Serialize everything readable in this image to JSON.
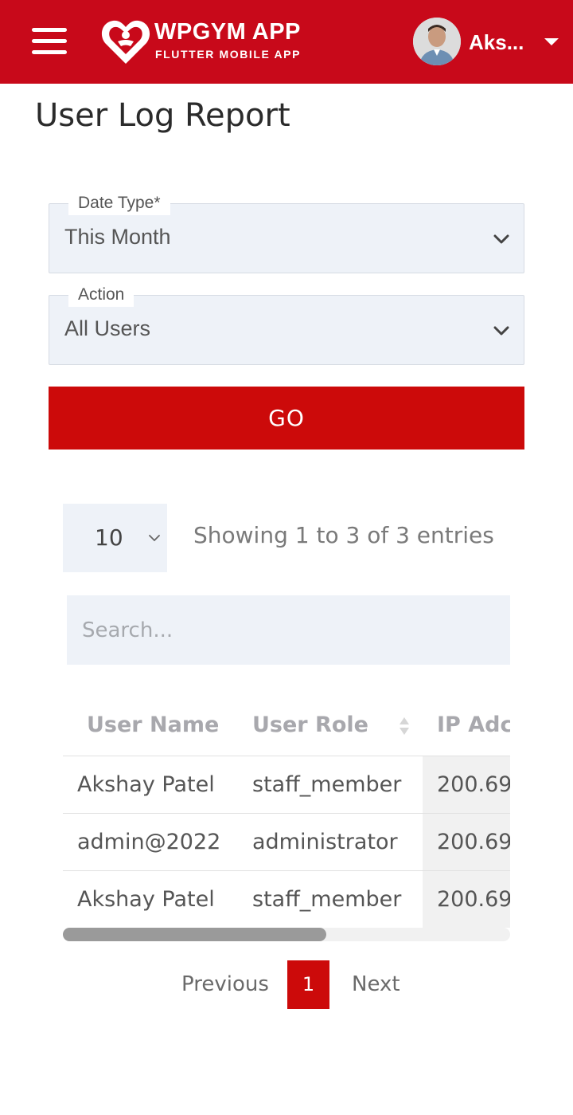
{
  "header": {
    "brand_title": "WPGYM APP",
    "brand_subtitle": "FLUTTER MOBILE APP",
    "user_name": "Aks...",
    "bar_color": "#c8091a"
  },
  "page": {
    "title": "User Log Report"
  },
  "filters": {
    "date_type": {
      "label": "Date Type*",
      "value": "This Month"
    },
    "action": {
      "label": "Action",
      "value": "All Users"
    },
    "go_label": "GO"
  },
  "table_controls": {
    "page_length": "10",
    "entries_info": "Showing 1 to 3 of 3 entries",
    "search_placeholder": "Search..."
  },
  "table": {
    "columns": [
      "User Name",
      "User Role",
      "IP Adc"
    ],
    "rows": [
      {
        "user_name": "Akshay Patel",
        "user_role": "staff_member",
        "ip": "200.69."
      },
      {
        "user_name": "admin@2022",
        "user_role": "administrator",
        "ip": "200.69."
      },
      {
        "user_name": "Akshay Patel",
        "user_role": "staff_member",
        "ip": "200.69."
      }
    ]
  },
  "pagination": {
    "previous": "Previous",
    "current": "1",
    "next": "Next"
  },
  "icons": {
    "menu": "hamburger-menu-icon",
    "logo": "heart-logo-icon",
    "dropdown": "caret-down-icon",
    "select": "chevron-down-icon",
    "sort": "sort-icon"
  },
  "colors": {
    "accent": "#cc0a0a",
    "field_bg": "#eef2f8"
  }
}
